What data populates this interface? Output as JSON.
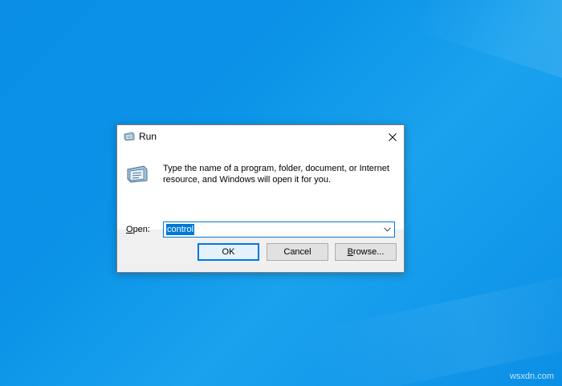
{
  "dialog": {
    "title": "Run",
    "description": "Type the name of a program, folder, document, or Internet resource, and Windows will open it for you.",
    "open_label_mnemonic": "O",
    "open_label_rest": "pen:",
    "open_value": "control",
    "buttons": {
      "ok": "OK",
      "cancel": "Cancel",
      "browse_mnemonic": "B",
      "browse_rest": "rowse..."
    },
    "icons": {
      "title": "run-icon",
      "body": "run-icon",
      "close": "close-icon",
      "dropdown": "chevron-down-icon"
    }
  },
  "watermark": "wsxdn.com",
  "colors": {
    "desktop": "#0b93e8",
    "accent": "#0078d7"
  }
}
